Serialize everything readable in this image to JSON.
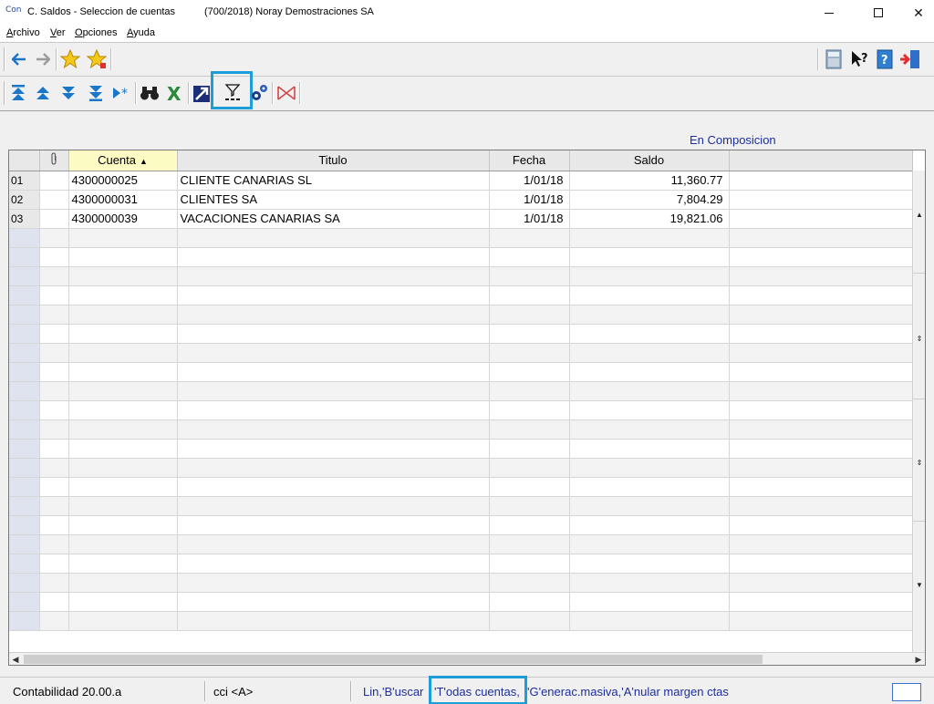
{
  "window": {
    "app_badge": "Con",
    "title": "C. Saldos - Seleccion de cuentas",
    "company": "(700/2018) Noray Demostraciones SA",
    "close_glyph": "✕"
  },
  "menu": [
    {
      "label_u": "A",
      "label_rest": "rchivo"
    },
    {
      "label_u": "V",
      "label_rest": "er"
    },
    {
      "label_u": "O",
      "label_rest": "pciones"
    },
    {
      "label_u": "A",
      "label_rest": "yuda"
    }
  ],
  "composition_label": "En Composicion",
  "table": {
    "columns": [
      "",
      "",
      "Cuenta",
      "Titulo",
      "Fecha",
      "Saldo",
      ""
    ],
    "sort_arrow": "▲",
    "rows": [
      {
        "n": "01",
        "cuenta": "4300000025",
        "titulo": "CLIENTE CANARIAS SL",
        "fecha": "1/01/18",
        "saldo": "11,360.77"
      },
      {
        "n": "02",
        "cuenta": "4300000031",
        "titulo": "CLIENTES SA",
        "fecha": "1/01/18",
        "saldo": "7,804.29"
      },
      {
        "n": "03",
        "cuenta": "4300000039",
        "titulo": "VACACIONES CANARIAS SA",
        "fecha": "1/01/18",
        "saldo": "19,821.06"
      }
    ]
  },
  "status": {
    "version": "Contabilidad 20.00.a",
    "mode": "cci <A>",
    "hint_a": "Lin,'B'uscar",
    "hint_b": "'T'odas cuentas,",
    "hint_c": "'G'enerac.masiva,'A'nular margen ctas"
  },
  "icons": {
    "back": "arrow-left-icon",
    "forward": "arrow-right-icon",
    "fav1": "star-icon",
    "fav2": "star-add-icon",
    "calc": "calculator-icon",
    "help": "help-pointer-icon",
    "manual": "help-book-icon",
    "exit": "exit-door-icon",
    "first": "first-record-icon",
    "prev": "previous-record-icon",
    "next": "next-record-icon",
    "last": "last-record-icon",
    "new": "insert-record-icon",
    "find": "binoculars-icon",
    "excel": "excel-icon",
    "export": "export-icon",
    "filter": "filter-icon",
    "settings": "gears-icon",
    "margin": "cancel-margin-icon"
  },
  "colors": {
    "highlight": "#1e9ed8",
    "link_blue": "#1c2ea0",
    "sorted_header": "#fdfbc4"
  }
}
